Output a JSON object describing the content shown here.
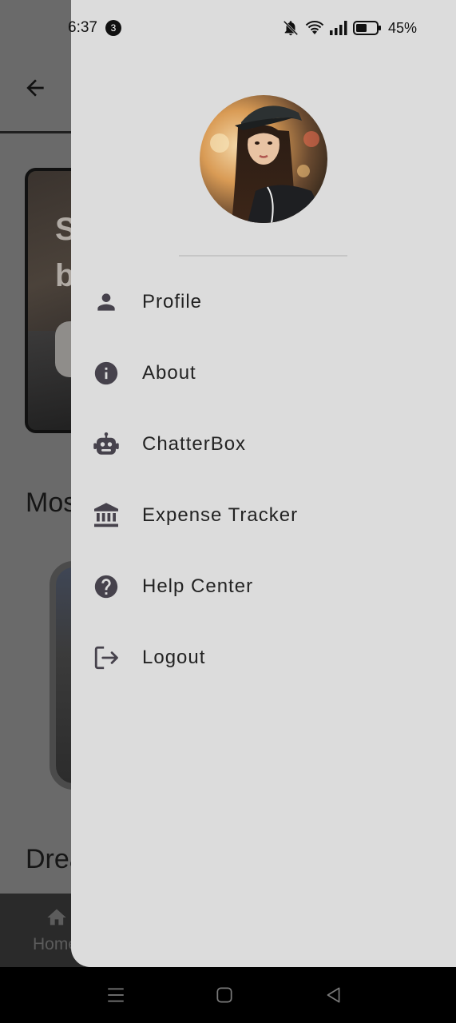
{
  "status_bar": {
    "time": "6:37",
    "notification_count": "3",
    "battery_percent": "45%"
  },
  "background_app": {
    "banner_text": "S b",
    "section_title": "Mos",
    "card_title": "Drea",
    "bottom_nav_home_label": "Home"
  },
  "drawer": {
    "menu": [
      {
        "label": "Profile",
        "icon": "person-icon"
      },
      {
        "label": "About",
        "icon": "info-icon"
      },
      {
        "label": "ChatterBox",
        "icon": "robot-icon"
      },
      {
        "label": "Expense Tracker",
        "icon": "bank-icon"
      },
      {
        "label": "Help Center",
        "icon": "help-icon"
      },
      {
        "label": "Logout",
        "icon": "logout-icon"
      }
    ]
  },
  "colors": {
    "drawer_background": "#dcdcdc",
    "icon_color": "#46424c",
    "scrim": "#6a6a6a"
  }
}
